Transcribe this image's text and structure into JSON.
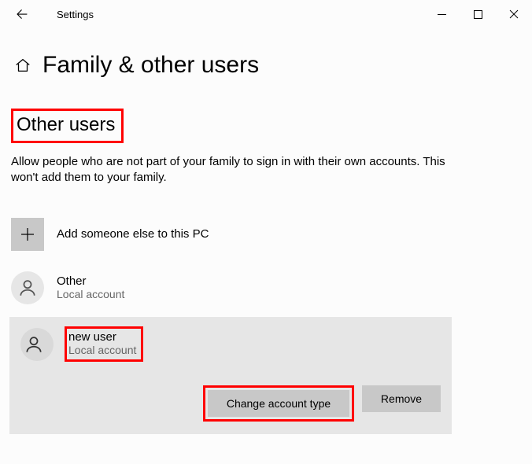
{
  "titlebar": {
    "app_title": "Settings"
  },
  "header": {
    "title": "Family & other users"
  },
  "section": {
    "title": "Other users",
    "description": "Allow people who are not part of your family to sign in with their own accounts. This won't add them to your family."
  },
  "add": {
    "label": "Add someone else to this PC"
  },
  "users": [
    {
      "name": "Other",
      "sub": "Local account"
    },
    {
      "name": "new user",
      "sub": "Local account"
    }
  ],
  "actions": {
    "change": "Change account type",
    "remove": "Remove"
  }
}
